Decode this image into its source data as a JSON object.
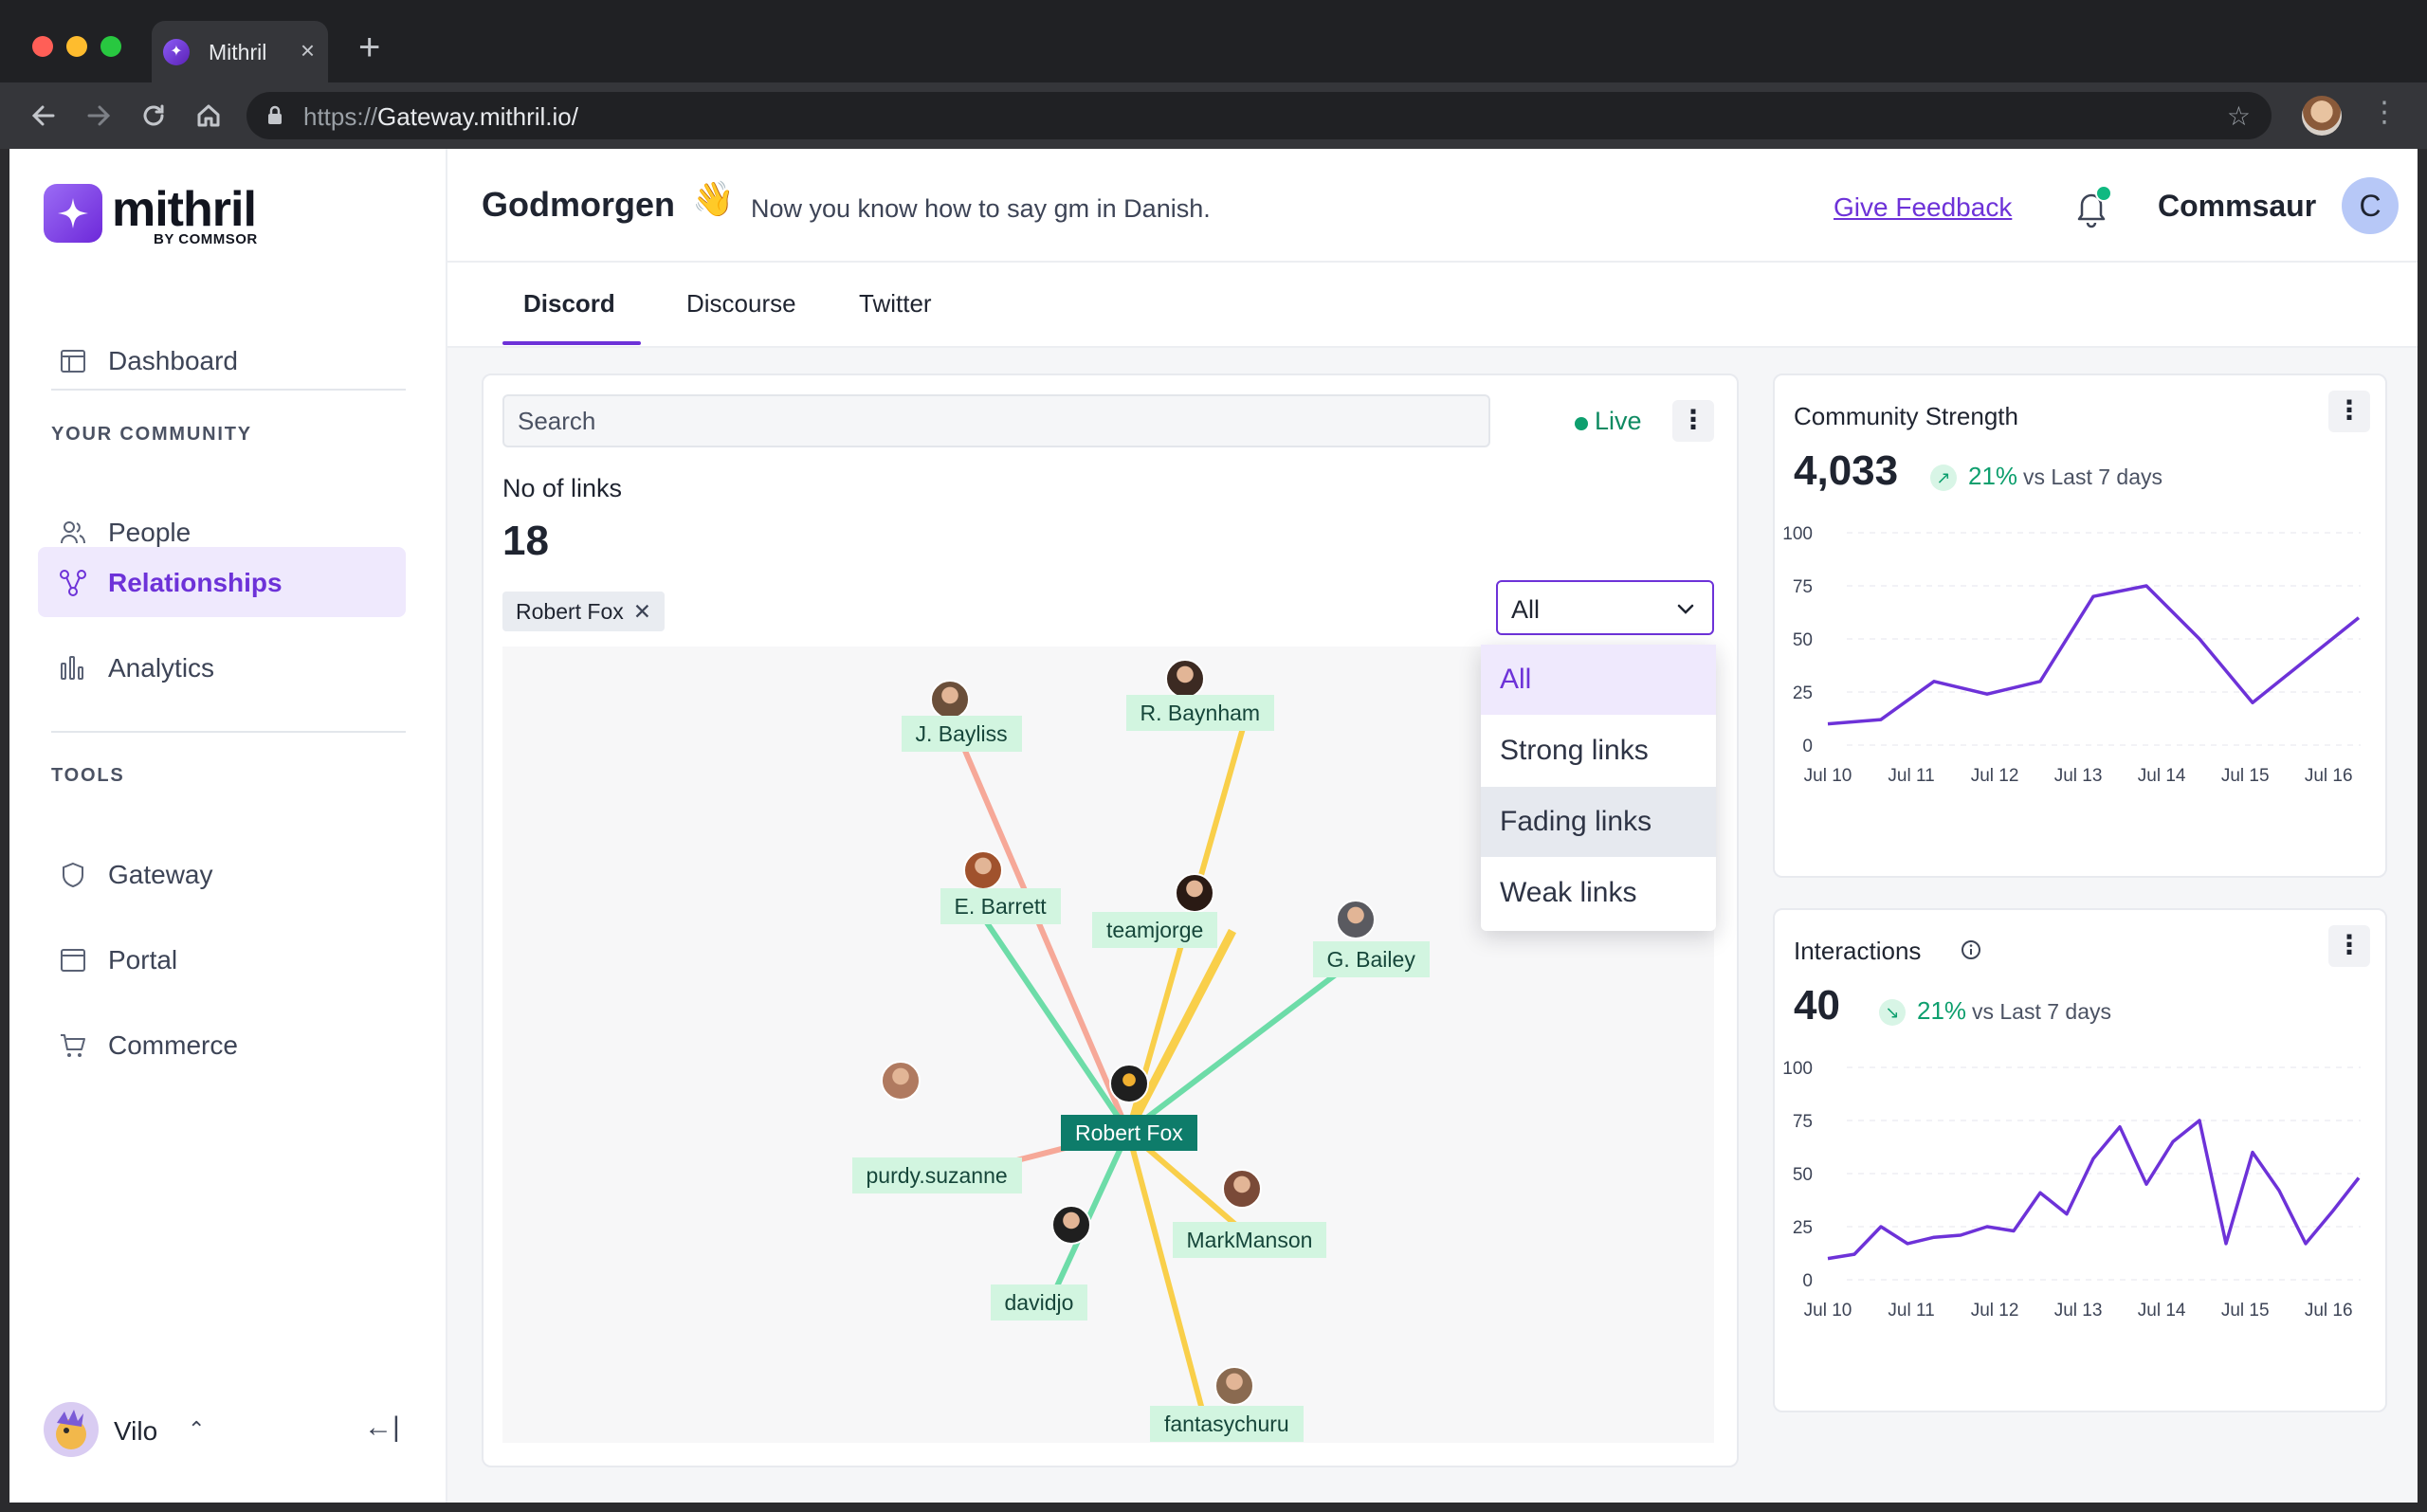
{
  "browser": {
    "tab_title": "Mithril",
    "url_protocol": "https://",
    "url_host": "Gateway.mithril.io/"
  },
  "sidebar": {
    "logo": "mithril",
    "logo_sub": "BY COMMSOR",
    "items": [
      {
        "label": "Dashboard",
        "icon": "layout-icon"
      },
      {
        "label": "People",
        "icon": "people-icon"
      },
      {
        "label": "Relationships",
        "icon": "relationships-icon",
        "active": true
      },
      {
        "label": "Analytics",
        "icon": "bar-chart-icon"
      },
      {
        "label": "Gateway",
        "icon": "shield-icon"
      },
      {
        "label": "Portal",
        "icon": "browser-window-icon"
      },
      {
        "label": "Commerce",
        "icon": "cart-icon"
      }
    ],
    "section_community": "YOUR COMMUNITY",
    "section_tools": "TOOLS",
    "user": {
      "name": "Vilo"
    }
  },
  "header": {
    "greeting": "Godmorgen",
    "emoji": "👋",
    "subtitle": "Now you know how to say gm in Danish.",
    "feedback": "Give Feedback",
    "org": "Commsaur",
    "org_initial": "C"
  },
  "tabs": [
    "Discord",
    "Discourse",
    "Twitter"
  ],
  "graph": {
    "search_placeholder": "Search",
    "live": "Live",
    "links_label": "No of links",
    "links_value": "18",
    "filter_chip": "Robert Fox",
    "select_value": "All",
    "dropdown": [
      "All",
      "Strong links",
      "Fading links",
      "Weak links"
    ],
    "center": "Robert Fox",
    "nodes": [
      {
        "name": "J. Bayliss",
        "strength": "fading"
      },
      {
        "name": "R. Baynham",
        "strength": "weak"
      },
      {
        "name": "E. Barrett",
        "strength": "strong"
      },
      {
        "name": "teamjorge",
        "strength": "weak"
      },
      {
        "name": "G. Bailey",
        "strength": "strong"
      },
      {
        "name": "purdy.suzanne",
        "strength": "fading"
      },
      {
        "name": "MarkManson",
        "strength": "weak"
      },
      {
        "name": "davidjo",
        "strength": "strong"
      },
      {
        "name": "fantasychuru",
        "strength": "weak"
      }
    ],
    "colors": {
      "strong": "#6ddca8",
      "fading": "#f6a898",
      "weak": "#f9cf4a"
    }
  },
  "community_strength": {
    "title": "Community Strength",
    "value": "4,033",
    "trend": "21%",
    "trend_dir": "up",
    "reference": "vs Last 7 days"
  },
  "interactions": {
    "title": "Interactions",
    "value": "40",
    "trend": "21%",
    "trend_dir": "down",
    "reference": "vs Last 7 days"
  },
  "chart_data": [
    {
      "type": "line",
      "title": "Community Strength",
      "x": [
        "Jul 10",
        "",
        "Jul 11",
        "",
        "Jul 12",
        "",
        "Jul 13",
        "",
        "Jul 14",
        "",
        "Jul 15",
        "",
        "Jul 16"
      ],
      "x_ticks": [
        "Jul 10",
        "Jul 11",
        "Jul 12",
        "Jul 13",
        "Jul 14",
        "Jul 15",
        "Jul 16"
      ],
      "values": [
        10,
        12,
        30,
        24,
        30,
        70,
        75,
        50,
        20,
        40,
        60
      ],
      "yticks": [
        0,
        25,
        50,
        75,
        100
      ],
      "ylim": [
        0,
        100
      ],
      "color": "#6d32d8"
    },
    {
      "type": "line",
      "title": "Interactions",
      "x_ticks": [
        "Jul 10",
        "Jul 11",
        "Jul 12",
        "Jul 13",
        "Jul 14",
        "Jul 15",
        "Jul 16"
      ],
      "values": [
        10,
        12,
        25,
        17,
        20,
        21,
        25,
        23,
        41,
        31,
        57,
        72,
        45,
        65,
        75,
        17,
        60,
        42,
        17,
        32,
        48
      ],
      "yticks": [
        0,
        25,
        50,
        75,
        100
      ],
      "ylim": [
        0,
        100
      ],
      "color": "#6d32d8"
    }
  ]
}
